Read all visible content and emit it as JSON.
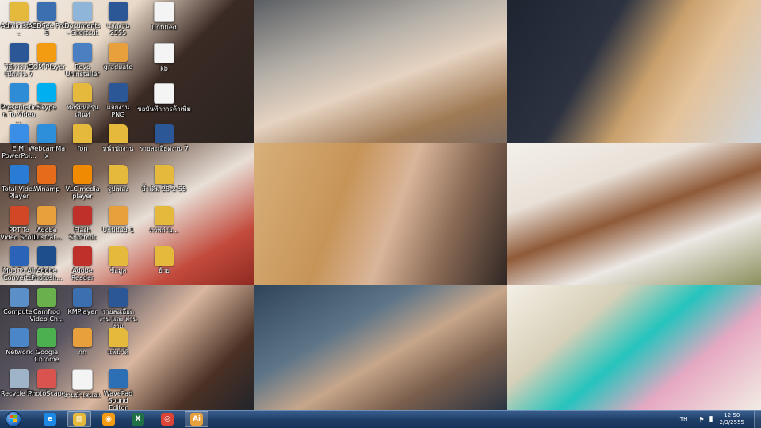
{
  "desktop": {
    "icons": [
      {
        "label": "Administra...",
        "icon": "folder-icon",
        "color": "#e5b93c"
      },
      {
        "label": "ACDSee Pro 3",
        "icon": "acdsee-icon",
        "color": "#3b6fb0"
      },
      {
        "label": "Documents - Shortcut",
        "icon": "documents-icon",
        "color": "#8fb5d8"
      },
      {
        "label": "แจกงาน 2555",
        "icon": "word-doc-icon",
        "color": "#2b5797"
      },
      {
        "label": "Untitled",
        "icon": "document-icon",
        "color": "#e8e8e8"
      },
      {
        "label": "วิธีการวางเปิดลาน 7",
        "icon": "word-doc-icon",
        "color": "#2b5797"
      },
      {
        "label": "GOM Player",
        "icon": "gom-player-icon",
        "color": "#f39c12"
      },
      {
        "label": "Revo Uninstaller",
        "icon": "revo-icon",
        "color": "#4a7fc1"
      },
      {
        "label": "graduate",
        "icon": "illustrator-icon",
        "color": "#e8a03c"
      },
      {
        "label": "kb",
        "icon": "document-icon",
        "color": "#e8e8e8"
      },
      {
        "label": "Presentation To Video ...",
        "icon": "presentation-icon",
        "color": "#2e8bd6"
      },
      {
        "label": "Skype",
        "icon": "skype-icon",
        "color": "#00aff0"
      },
      {
        "label": "ฟอร์มหอรุ่นเดินท่",
        "icon": "folder-icon",
        "color": "#e5b93c"
      },
      {
        "label": "แจกงาน PNG",
        "icon": "word-doc-icon",
        "color": "#2b5797"
      },
      {
        "label": "ขอบันทึกการค้าเพิ่ม",
        "icon": "document-icon",
        "color": "#e8e8e8"
      },
      {
        "label": "E.M. PowerPoi...",
        "icon": "powerpoint-tool-icon",
        "color": "#3a8ee6"
      },
      {
        "label": "WebcamMax",
        "icon": "webcammax-icon",
        "color": "#2d8fd9"
      },
      {
        "label": "fon",
        "icon": "folder-icon",
        "color": "#e5b93c"
      },
      {
        "label": "หน้าปกงาน",
        "icon": "folder-icon",
        "color": "#e5b93c"
      },
      {
        "label": "รายละเอียดงาน 7",
        "icon": "word-doc-icon",
        "color": "#2b5797"
      },
      {
        "label": "Total Video Player",
        "icon": "total-video-icon",
        "color": "#2a7bd4"
      },
      {
        "label": "Winamp",
        "icon": "winamp-icon",
        "color": "#e56c1b"
      },
      {
        "label": "VLC media player",
        "icon": "vlc-icon",
        "color": "#f08a00"
      },
      {
        "label": "รูปเพลง",
        "icon": "folder-icon",
        "color": "#e5b93c"
      },
      {
        "label": "ย้ำเดิม 28-2-55",
        "icon": "folder-icon",
        "color": "#e5b93c"
      },
      {
        "label": "PPT To Video Scout",
        "icon": "ppt-video-icon",
        "color": "#d24726"
      },
      {
        "label": "Adobe Illustrat...",
        "icon": "illustrator-icon",
        "color": "#e8a03c"
      },
      {
        "label": "Flash Shortcut",
        "icon": "flash-icon",
        "color": "#c0302a"
      },
      {
        "label": "Untitled-1",
        "icon": "illustrator-icon",
        "color": "#e8a03c"
      },
      {
        "label": "ภาพถ่าย...",
        "icon": "folder-icon",
        "color": "#e5b93c"
      },
      {
        "label": "Mp3 To All Converter",
        "icon": "mp3-converter-icon",
        "color": "#2a63b8"
      },
      {
        "label": "Adobe Photosh...",
        "icon": "photoshop-icon",
        "color": "#1f4e8c"
      },
      {
        "label": "Adobe Reader",
        "icon": "adobe-reader-icon",
        "color": "#c0302a"
      },
      {
        "label": "ข้อมูล",
        "icon": "folder-icon",
        "color": "#e5b93c"
      },
      {
        "label": "ย้าย",
        "icon": "folder-icon",
        "color": "#e5b93c"
      },
      {
        "label": "Computer",
        "icon": "computer-icon",
        "color": "#5a8fc8"
      },
      {
        "label": "Camfrog Video Ch...",
        "icon": "camfrog-icon",
        "color": "#6ab04c"
      },
      {
        "label": "KMPlayer",
        "icon": "kmplayer-icon",
        "color": "#3b6fb0"
      },
      {
        "label": "รายละเอียดงาน และ ผ่านงาน",
        "icon": "word-doc-icon",
        "color": "#2b5797"
      },
      {
        "label": "Network",
        "icon": "network-icon",
        "color": "#4a86c8"
      },
      {
        "label": "Google Chrome",
        "icon": "chrome-icon",
        "color": "#4caf50"
      },
      {
        "label": "nn",
        "icon": "illustrator-icon",
        "color": "#e8a03c"
      },
      {
        "label": "แฟ้มวิดี",
        "icon": "folder-icon",
        "color": "#e5b93c"
      },
      {
        "label": "Recycle Bin",
        "icon": "recycle-bin-icon",
        "color": "#9fb4c9"
      },
      {
        "label": "PhotoScape",
        "icon": "photoscape-icon",
        "color": "#d9534f"
      },
      {
        "label": "งานนำเสนอแ",
        "icon": "document-icon",
        "color": "#e8e8e8"
      },
      {
        "label": "WavePad Sound Editor",
        "icon": "wavepad-icon",
        "color": "#2d6fb5"
      }
    ]
  },
  "taskbar": {
    "start_icon": "windows-start-icon",
    "pinned": [
      {
        "name": "internet-explorer-icon",
        "glyph": "e",
        "color": "#1e88e5",
        "active": false
      },
      {
        "name": "file-explorer-icon",
        "glyph": "▤",
        "color": "#e5b93c",
        "active": true
      },
      {
        "name": "media-player-icon",
        "glyph": "◉",
        "color": "#f39c12",
        "active": false
      },
      {
        "name": "excel-icon",
        "glyph": "X",
        "color": "#1e7145",
        "active": false
      },
      {
        "name": "chrome-icon",
        "glyph": "◎",
        "color": "#db4437",
        "active": false
      },
      {
        "name": "illustrator-icon",
        "glyph": "Ai",
        "color": "#e8a03c",
        "active": true
      }
    ],
    "tray": {
      "language": "TH",
      "time": "12:50",
      "date": "2/3/2555"
    }
  }
}
